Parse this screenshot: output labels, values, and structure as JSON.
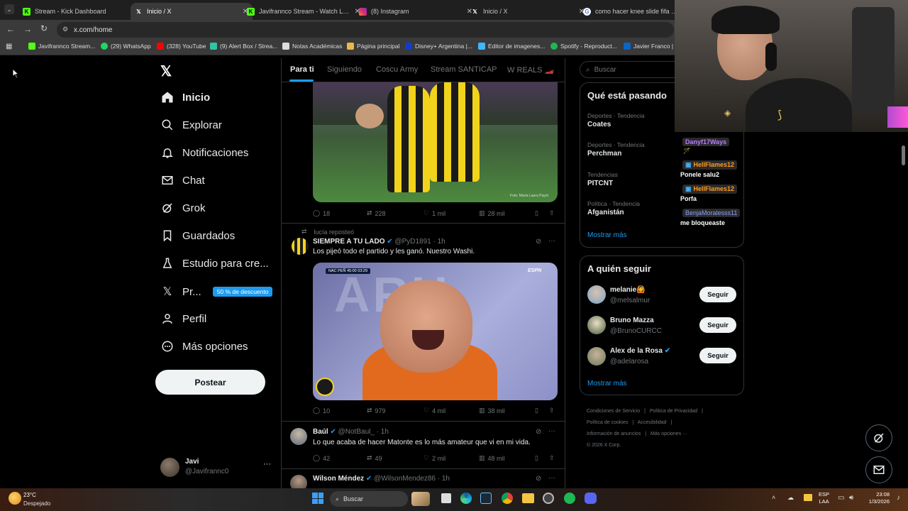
{
  "browser": {
    "tabs": [
      {
        "title": "Stream - Kick Dashboard",
        "icon": "kick-icon",
        "color": "#53fc18"
      },
      {
        "title": "Inicio / X",
        "icon": "x-logo-icon",
        "color": "#ffffff"
      },
      {
        "title": "Javifrannco Stream - Watch Live",
        "icon": "kick-icon",
        "color": "#53fc18"
      },
      {
        "title": "(8) Instagram",
        "icon": "instagram-icon",
        "color": "#e1306c"
      },
      {
        "title": "Inicio / X",
        "icon": "x-logo-icon",
        "color": "#ffffff"
      },
      {
        "title": "como hacer knee slide fifa - Bu",
        "icon": "google-icon",
        "color": "#4285f4"
      }
    ],
    "url": "x.com/home",
    "bookmarks": [
      {
        "label": "Javifrannco Stream...",
        "color": "#53fc18"
      },
      {
        "label": "(29) WhatsApp",
        "color": "#25d366"
      },
      {
        "label": "(328) YouTube",
        "color": "#ff0000"
      },
      {
        "label": "(9) Alert Box / Strea...",
        "color": "#31c3a2"
      },
      {
        "label": "Notas Académicas",
        "color": "#dddddd"
      },
      {
        "label": "Página principal",
        "color": "#e8b84a"
      },
      {
        "label": "Disney+ Argentina |...",
        "color": "#113ccf"
      },
      {
        "label": "Editor de imagenes...",
        "color": "#3fb6ff"
      },
      {
        "label": "Spotify - Reproduct...",
        "color": "#1db954"
      },
      {
        "label": "Javier Franco | Li",
        "color": "#0a66c2"
      }
    ]
  },
  "sidebar": {
    "items": [
      {
        "label": "Inicio",
        "icon": "home-icon"
      },
      {
        "label": "Explorar",
        "icon": "search-icon"
      },
      {
        "label": "Notificaciones",
        "icon": "bell-icon"
      },
      {
        "label": "Chat",
        "icon": "mail-icon"
      },
      {
        "label": "Grok",
        "icon": "grok-icon"
      },
      {
        "label": "Guardados",
        "icon": "bookmark-icon"
      },
      {
        "label": "Estudio para cre...",
        "icon": "flask-icon"
      },
      {
        "label": "Pr...",
        "icon": "x-logo-icon"
      },
      {
        "label": "Perfil",
        "icon": "person-icon"
      },
      {
        "label": "Más opciones",
        "icon": "more-circle-icon"
      }
    ],
    "premium_badge": "50 % de descuento",
    "post_button": "Postear",
    "user": {
      "name": "Javi",
      "handle": "@Javifrannc0"
    }
  },
  "feed": {
    "tabs": [
      "Para ti",
      "Siguiendo",
      "Coscu Army",
      "Stream SANTICAP",
      "W REALS 🏎️"
    ],
    "post1": {
      "photo_credit": "Foto: María Laura Payró",
      "stats": {
        "replies": "18",
        "reposts": "228",
        "likes": "1 mil",
        "views": "28 mil"
      }
    },
    "post2": {
      "repost_by": "lucía reposteó",
      "name": "SIEMPRE A TU LADO",
      "handle": "@PyD1891",
      "time": "· 1h",
      "text": "Los pijeó todo el partido y les ganó. Nuestro Washi.",
      "scoreboard": "NAC  PEÑ  45:00  03:29",
      "image_watermark": "ESPN",
      "stats": {
        "replies": "10",
        "reposts": "979",
        "likes": "4 mil",
        "views": "38 mil"
      }
    },
    "post3": {
      "name": "Baúl",
      "handle": "@NotBaul_",
      "time": "· 1h",
      "text": "Lo que acaba de hacer Matonte es lo más amateur que vi en mi vida.",
      "stats": {
        "replies": "42",
        "reposts": "49",
        "likes": "2 mil",
        "views": "48 mil"
      }
    },
    "post4": {
      "name": "Wilson Méndez",
      "handle": "@WilsonMendez86",
      "time": "· 1h"
    }
  },
  "right": {
    "search_placeholder": "Buscar",
    "trends_title": "Qué está pasando",
    "trends": [
      {
        "category": "Deportes · Tendencia",
        "name": "Coates"
      },
      {
        "category": "Deportes · Tendencia",
        "name": "Perchman"
      },
      {
        "category": "Tendencias",
        "name": "PITCNT"
      },
      {
        "category": "Política · Tendencia",
        "name": "Afganistán"
      }
    ],
    "show_more": "Mostrar más",
    "follow_title": "A quién seguir",
    "follow": [
      {
        "name": "melanie🙆",
        "handle": "@melsalmur",
        "button": "Seguir"
      },
      {
        "name": "Bruno Mazza",
        "handle": "@BrunoCURCC",
        "button": "Seguir"
      },
      {
        "name": "Alex de la Rosa",
        "handle": "@adelarosa",
        "button": "Seguir"
      }
    ],
    "show_more2": "Mostrar más",
    "footer": [
      "Condiciones de Servicio",
      "Política de Privacidad",
      "Política de cookies",
      "Accesibilidad",
      "Información de anuncios",
      "Más opciones ···",
      "© 2026 X Corp."
    ]
  },
  "stream_chat": [
    {
      "user": "Danyf17Ways",
      "msg": "",
      "color": "#b77cff"
    },
    {
      "user": "HellFlames12",
      "msg": "Ponele salu2",
      "color": "#ff9a1f"
    },
    {
      "user": "HellFlames12",
      "msg": "Porfa",
      "color": "#ff9a1f"
    },
    {
      "user": "BenjaMoralesss11",
      "msg": "me bloqueaste",
      "color": "#8aa0ff"
    }
  ],
  "taskbar": {
    "weather_temp": "23°C",
    "weather_desc": "Despejado",
    "search": "Buscar",
    "lang": "ESP",
    "lang2": "LAA",
    "time": "23:08",
    "date": "1/3/2026"
  }
}
